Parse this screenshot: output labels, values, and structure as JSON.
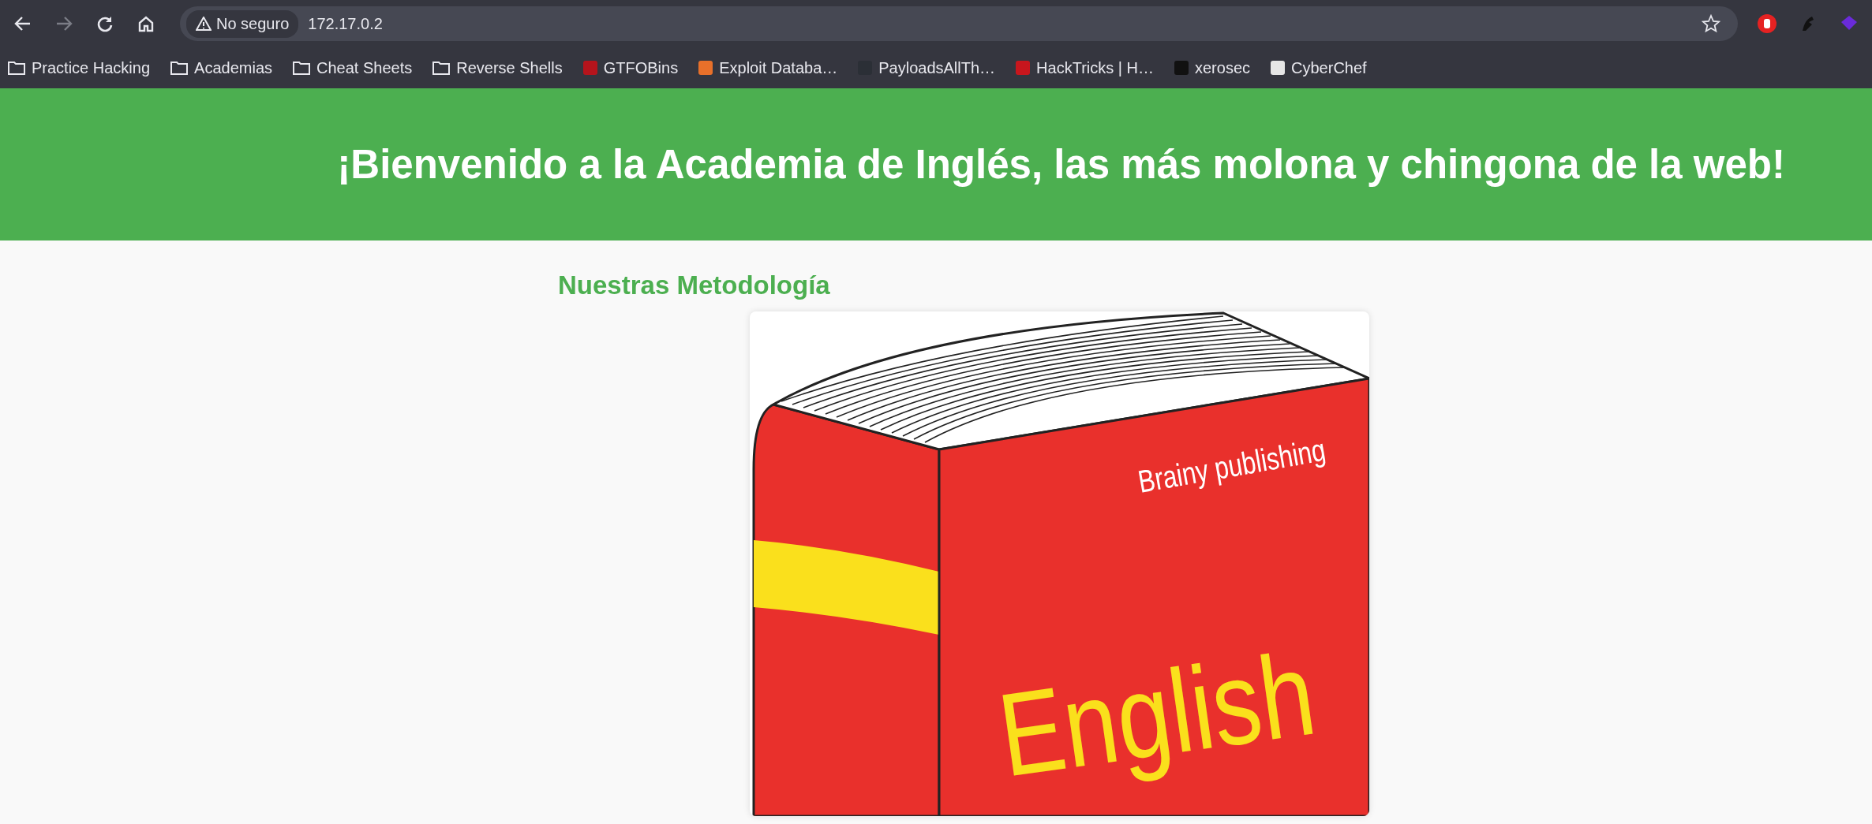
{
  "browser": {
    "security_label": "No seguro",
    "url": "172.17.0.2"
  },
  "bookmarks": [
    {
      "kind": "folder",
      "label": "Practice Hacking"
    },
    {
      "kind": "folder",
      "label": "Academias"
    },
    {
      "kind": "folder",
      "label": "Cheat Sheets"
    },
    {
      "kind": "folder",
      "label": "Reverse Shells"
    },
    {
      "kind": "site",
      "label": "GTFOBins",
      "color": "#b5141c"
    },
    {
      "kind": "site",
      "label": "Exploit Databa…",
      "color": "#e8702a"
    },
    {
      "kind": "site",
      "label": "PayloadsAllTh…",
      "color": "#2b2f36"
    },
    {
      "kind": "site",
      "label": "HackTricks | H…",
      "color": "#c8161d"
    },
    {
      "kind": "site",
      "label": "xerosec",
      "color": "#111111"
    },
    {
      "kind": "site",
      "label": "CyberChef",
      "color": "#e6e6e6"
    }
  ],
  "header": {
    "title": "¡Bienvenido a la Academia de Inglés, las más molona y chingona de la web!"
  },
  "section": {
    "heading": "Nuestras Metodología",
    "image": {
      "publisher": "Brainy publishing",
      "cover_title": "English"
    }
  }
}
